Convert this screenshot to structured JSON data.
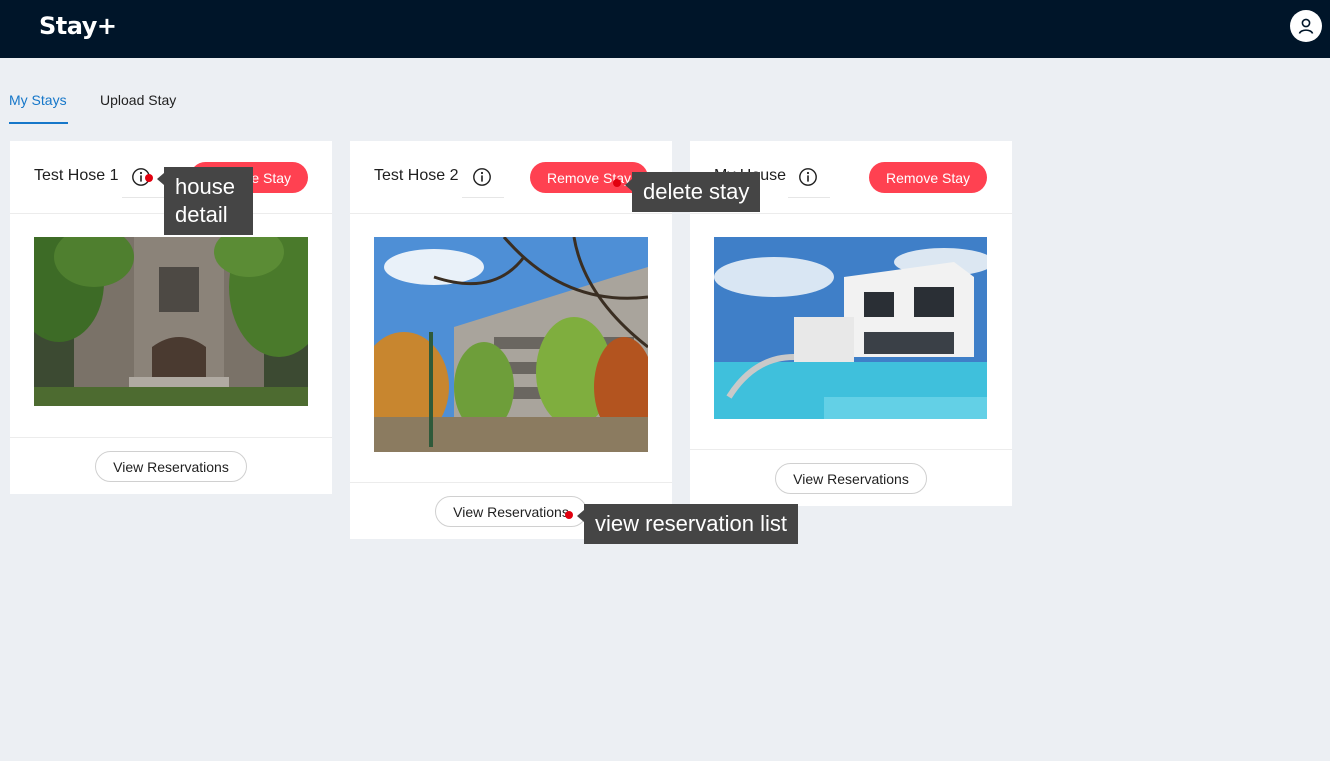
{
  "app": {
    "title": "Stay+"
  },
  "header": {
    "profile_icon": "user-icon"
  },
  "tabs": [
    {
      "label": "My Stays",
      "active": true
    },
    {
      "label": "Upload Stay",
      "active": false
    }
  ],
  "stays": [
    {
      "title": "Test Hose 1",
      "remove_label": "Remove Stay",
      "view_label": "View Reservations",
      "info_icon": "info-circle-icon"
    },
    {
      "title": "Test Hose 2",
      "remove_label": "Remove Stay",
      "view_label": "View Reservations",
      "info_icon": "info-circle-icon"
    },
    {
      "title": "My House",
      "remove_label": "Remove Stay",
      "view_label": "View Reservations",
      "info_icon": "info-circle-icon"
    }
  ],
  "annotations": [
    {
      "text": "house detail"
    },
    {
      "text": "delete stay"
    },
    {
      "text": "view reservation list"
    }
  ],
  "colors": {
    "header_bg": "#001529",
    "accent": "#1677c9",
    "danger": "#ff4151",
    "page_bg": "#eceff3"
  }
}
